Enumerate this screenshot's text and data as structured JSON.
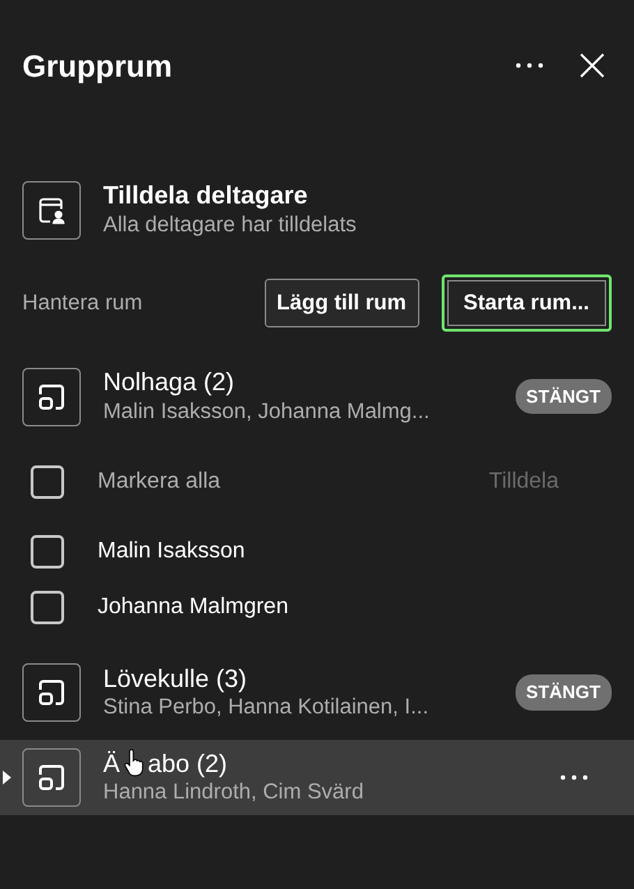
{
  "header": {
    "title": "Grupprum"
  },
  "assign": {
    "title": "Tilldela deltagare",
    "subtitle": "Alla deltagare har tilldelats"
  },
  "manage": {
    "label": "Hantera rum",
    "buttons": [
      {
        "label": "Lägg till rum",
        "focused": false
      },
      {
        "label": "Starta rum...",
        "focused": true
      }
    ]
  },
  "rooms": [
    {
      "title": "Nolhaga (2)",
      "members": "Malin Isaksson, Johanna Malmg...",
      "status": "STÄNGT",
      "selected": false,
      "select_all": {
        "label": "Markera alla",
        "checked": false,
        "disabled": true
      },
      "assign_label": "Tilldela",
      "participants": [
        {
          "name": "Malin Isaksson",
          "checked": false
        },
        {
          "name": "Johanna Malmgren",
          "checked": false
        }
      ]
    },
    {
      "title": "Lövekulle (3)",
      "members": "Stina Perbo, Hanna Kotilainen, I...",
      "status": "STÄNGT",
      "selected": false
    },
    {
      "title": "Ä",
      "title_continued": "abo (2)",
      "members": "Hanna Lindroth, Cim Svärd",
      "selected": true
    }
  ]
}
